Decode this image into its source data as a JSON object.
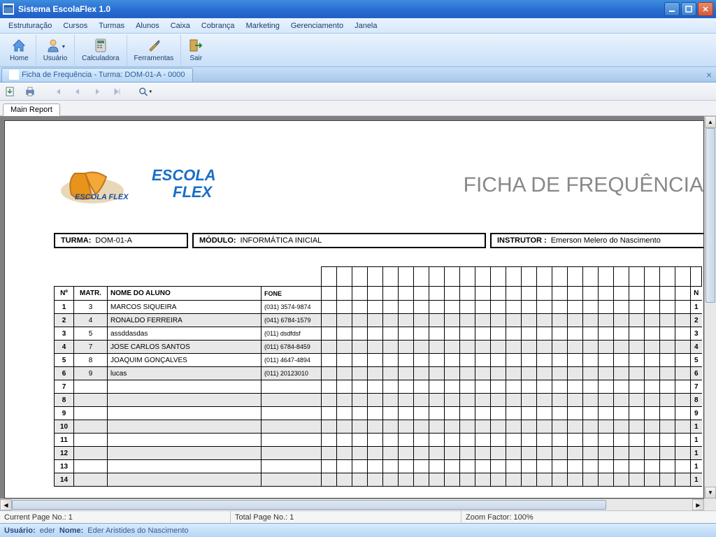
{
  "window": {
    "title": "Sistema EscolaFlex 1.0"
  },
  "menu": [
    "Estruturação",
    "Cursos",
    "Turmas",
    "Alunos",
    "Caixa",
    "Cobrança",
    "Marketing",
    "Gerenciamento",
    "Janela"
  ],
  "toolbar": [
    {
      "label": "Home",
      "icon": "home-icon"
    },
    {
      "label": "Usuário",
      "icon": "user-icon",
      "dropdown": true
    },
    {
      "label": "Calculadora",
      "icon": "calculator-icon"
    },
    {
      "label": "Ferramentas",
      "icon": "tools-icon"
    },
    {
      "label": "Sair",
      "icon": "exit-icon"
    }
  ],
  "subtab": {
    "title": "Ficha de Frequência - Turma: DOM-01-A - 0000"
  },
  "report_tabs": {
    "main": "Main Report"
  },
  "report": {
    "logo_line1": "ESCOLA",
    "logo_line2": "FLEX",
    "title": "FICHA DE FREQUÊNCIA",
    "turma_label": "TURMA:",
    "turma_value": "DOM-01-A",
    "modulo_label": "MÓDULO:",
    "modulo_value": "INFORMÁTICA INICIAL",
    "instrutor_label": "INSTRUTOR :",
    "instrutor_value": "Emerson Melero do Nascimento",
    "headers": {
      "n": "Nº",
      "matr": "MATR.",
      "nome": "NOME DO ALUNO",
      "fone": "FONE"
    },
    "rows": [
      {
        "n": "1",
        "matr": "3",
        "nome": "MARCOS SIQUEIRA",
        "fone": "(031) 3574-9874"
      },
      {
        "n": "2",
        "matr": "4",
        "nome": "RONALDO FERREIRA",
        "fone": "(041) 6784-1579"
      },
      {
        "n": "3",
        "matr": "5",
        "nome": "assddasdas",
        "fone": "(011) dsdfdsf"
      },
      {
        "n": "4",
        "matr": "7",
        "nome": "JOSE CARLOS SANTOS",
        "fone": "(011) 6784-8459"
      },
      {
        "n": "5",
        "matr": "8",
        "nome": "JOAQUIM GONÇALVES",
        "fone": "(011) 4647-4894"
      },
      {
        "n": "6",
        "matr": "9",
        "nome": "lucas",
        "fone": "(011) 20123010"
      },
      {
        "n": "7",
        "matr": "",
        "nome": "",
        "fone": ""
      },
      {
        "n": "8",
        "matr": "",
        "nome": "",
        "fone": ""
      },
      {
        "n": "9",
        "matr": "",
        "nome": "",
        "fone": ""
      },
      {
        "n": "10",
        "matr": "",
        "nome": "",
        "fone": ""
      },
      {
        "n": "11",
        "matr": "",
        "nome": "",
        "fone": ""
      },
      {
        "n": "12",
        "matr": "",
        "nome": "",
        "fone": ""
      },
      {
        "n": "13",
        "matr": "",
        "nome": "",
        "fone": ""
      },
      {
        "n": "14",
        "matr": "",
        "nome": "",
        "fone": ""
      }
    ],
    "day_columns": 24,
    "last_col_header": "N",
    "last_col_values": [
      "1",
      "2",
      "3",
      "4",
      "5",
      "6",
      "7",
      "8",
      "9",
      "1",
      "1",
      "1",
      "1",
      "1"
    ]
  },
  "status": {
    "current_page_label": "Current Page No.:",
    "current_page": "1",
    "total_page_label": "Total Page No.:",
    "total_page": "1",
    "zoom_label": "Zoom Factor:",
    "zoom": "100%"
  },
  "userbar": {
    "usuario_label": "Usuário:",
    "usuario": "eder",
    "nome_label": "Nome:",
    "nome": "Eder Aristides do Nascimento"
  }
}
